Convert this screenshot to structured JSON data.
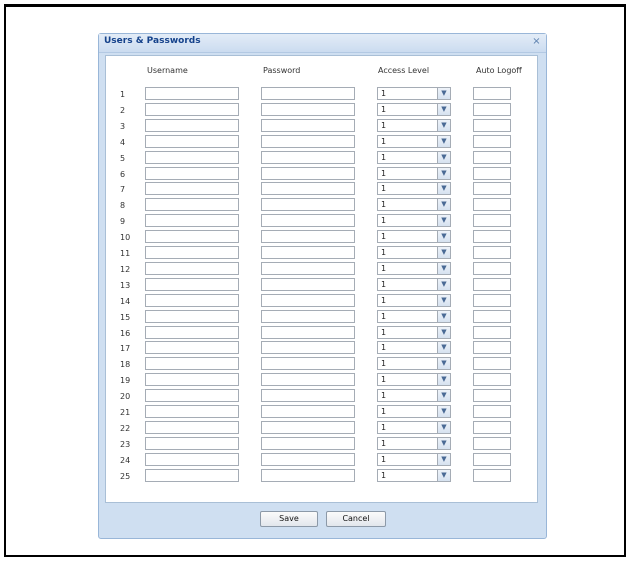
{
  "dialog": {
    "title": "Users & Passwords",
    "close_glyph": "×"
  },
  "columns": {
    "username": "Username",
    "password": "Password",
    "access_level": "Access Level",
    "auto_logoff": "Auto Logoff"
  },
  "rows": [
    {
      "num": "1",
      "username": "",
      "password": "",
      "access": "1",
      "logoff": ""
    },
    {
      "num": "2",
      "username": "",
      "password": "",
      "access": "1",
      "logoff": ""
    },
    {
      "num": "3",
      "username": "",
      "password": "",
      "access": "1",
      "logoff": ""
    },
    {
      "num": "4",
      "username": "",
      "password": "",
      "access": "1",
      "logoff": ""
    },
    {
      "num": "5",
      "username": "",
      "password": "",
      "access": "1",
      "logoff": ""
    },
    {
      "num": "6",
      "username": "",
      "password": "",
      "access": "1",
      "logoff": ""
    },
    {
      "num": "7",
      "username": "",
      "password": "",
      "access": "1",
      "logoff": ""
    },
    {
      "num": "8",
      "username": "",
      "password": "",
      "access": "1",
      "logoff": ""
    },
    {
      "num": "9",
      "username": "",
      "password": "",
      "access": "1",
      "logoff": ""
    },
    {
      "num": "10",
      "username": "",
      "password": "",
      "access": "1",
      "logoff": ""
    },
    {
      "num": "11",
      "username": "",
      "password": "",
      "access": "1",
      "logoff": ""
    },
    {
      "num": "12",
      "username": "",
      "password": "",
      "access": "1",
      "logoff": ""
    },
    {
      "num": "13",
      "username": "",
      "password": "",
      "access": "1",
      "logoff": ""
    },
    {
      "num": "14",
      "username": "",
      "password": "",
      "access": "1",
      "logoff": ""
    },
    {
      "num": "15",
      "username": "",
      "password": "",
      "access": "1",
      "logoff": ""
    },
    {
      "num": "16",
      "username": "",
      "password": "",
      "access": "1",
      "logoff": ""
    },
    {
      "num": "17",
      "username": "",
      "password": "",
      "access": "1",
      "logoff": ""
    },
    {
      "num": "18",
      "username": "",
      "password": "",
      "access": "1",
      "logoff": ""
    },
    {
      "num": "19",
      "username": "",
      "password": "",
      "access": "1",
      "logoff": ""
    },
    {
      "num": "20",
      "username": "",
      "password": "",
      "access": "1",
      "logoff": ""
    },
    {
      "num": "21",
      "username": "",
      "password": "",
      "access": "1",
      "logoff": ""
    },
    {
      "num": "22",
      "username": "",
      "password": "",
      "access": "1",
      "logoff": ""
    },
    {
      "num": "23",
      "username": "",
      "password": "",
      "access": "1",
      "logoff": ""
    },
    {
      "num": "24",
      "username": "",
      "password": "",
      "access": "1",
      "logoff": ""
    },
    {
      "num": "25",
      "username": "",
      "password": "",
      "access": "1",
      "logoff": ""
    }
  ],
  "buttons": {
    "save": "Save",
    "cancel": "Cancel"
  },
  "icons": {
    "dropdown": "chevron-down-icon",
    "close": "close-icon"
  },
  "colors": {
    "title_text": "#15428b",
    "dialog_bg": "#cfdff1"
  }
}
